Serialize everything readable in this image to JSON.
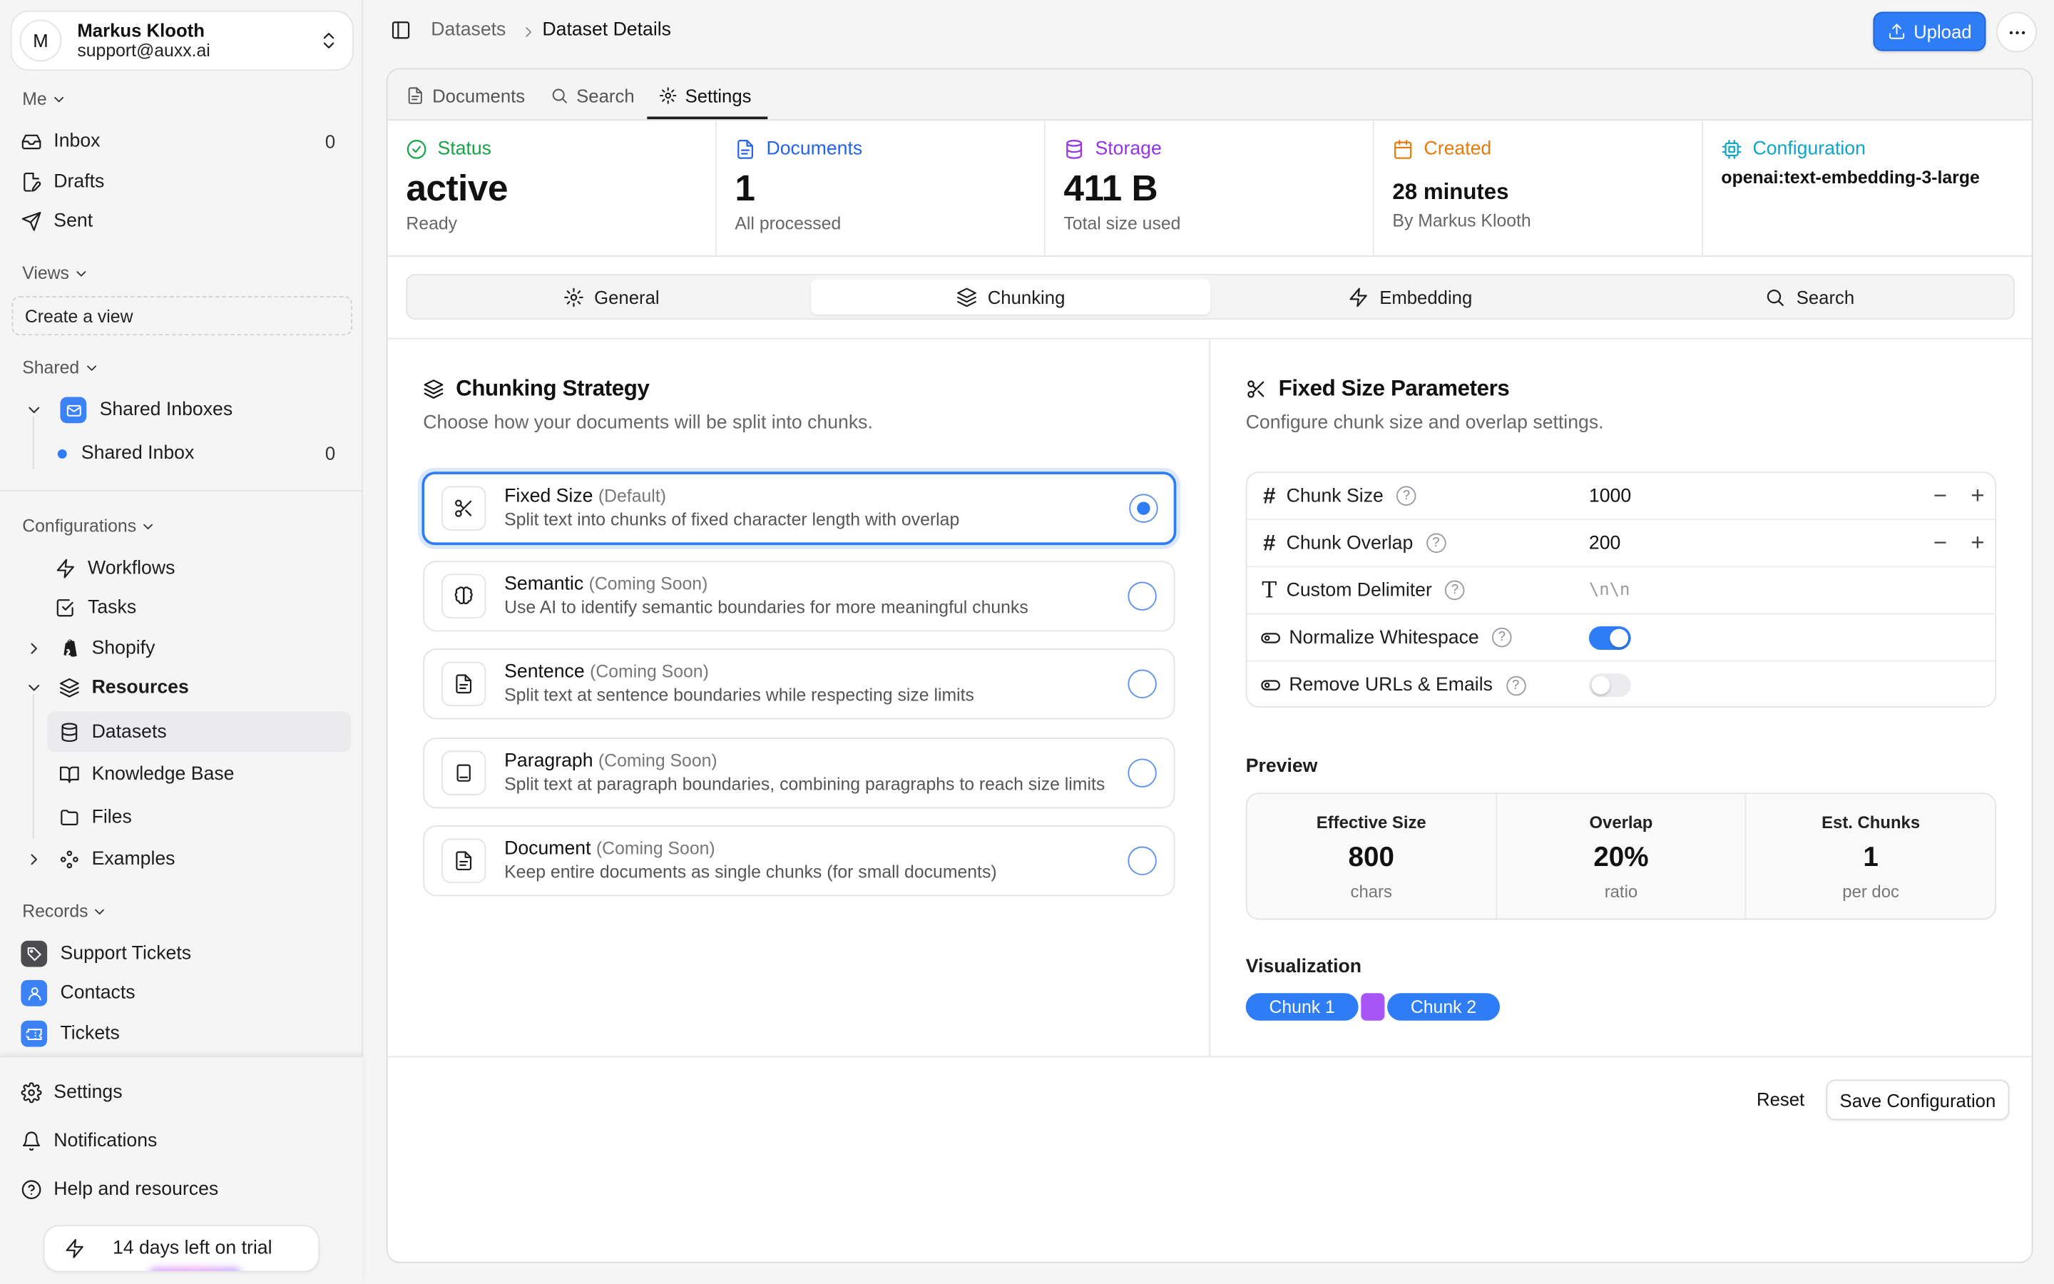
{
  "user": {
    "initial": "M",
    "name": "Markus Klooth",
    "email": "support@auxx.ai"
  },
  "sidebar": {
    "me_label": "Me",
    "inbox": {
      "label": "Inbox",
      "count": "0"
    },
    "drafts": "Drafts",
    "sent": "Sent",
    "views_label": "Views",
    "create_view": "Create a view",
    "shared_label": "Shared",
    "shared_inboxes": "Shared Inboxes",
    "shared_inbox": {
      "label": "Shared Inbox",
      "count": "0"
    },
    "configurations_label": "Configurations",
    "workflows": "Workflows",
    "tasks": "Tasks",
    "shopify": "Shopify",
    "resources": "Resources",
    "datasets": "Datasets",
    "knowledge_base": "Knowledge Base",
    "files": "Files",
    "examples": "Examples",
    "records_label": "Records",
    "support_tickets": "Support Tickets",
    "contacts": "Contacts",
    "tickets": "Tickets",
    "settings": "Settings",
    "notifications": "Notifications",
    "help": "Help and resources",
    "trial": "14 days left on trial"
  },
  "breadcrumb": {
    "parent": "Datasets",
    "current": "Dataset Details"
  },
  "toolbar": {
    "upload": "Upload"
  },
  "tabs": {
    "documents": "Documents",
    "search": "Search",
    "settings": "Settings"
  },
  "stats": {
    "status": {
      "label": "Status",
      "value": "active",
      "sub": "Ready",
      "color": "#16a34a"
    },
    "documents": {
      "label": "Documents",
      "value": "1",
      "sub": "All processed",
      "color": "#2563eb"
    },
    "storage": {
      "label": "Storage",
      "value": "411 B",
      "sub": "Total size used",
      "color": "#9333ea"
    },
    "created": {
      "label": "Created",
      "value": "28 minutes",
      "sub": "By Markus Klooth",
      "color": "#ea7a0c"
    },
    "configuration": {
      "label": "Configuration",
      "value": "openai:text-embedding-3-large",
      "color": "#0ea5c9"
    }
  },
  "subtabs": {
    "general": "General",
    "chunking": "Chunking",
    "embedding": "Embedding",
    "search": "Search"
  },
  "strategy": {
    "title": "Chunking Strategy",
    "desc": "Choose how your documents will be split into chunks.",
    "options": [
      {
        "title": "Fixed Size",
        "tag": "(Default)",
        "desc": "Split text into chunks of fixed character length with overlap"
      },
      {
        "title": "Semantic",
        "tag": "(Coming Soon)",
        "desc": "Use AI to identify semantic boundaries for more meaningful chunks"
      },
      {
        "title": "Sentence",
        "tag": "(Coming Soon)",
        "desc": "Split text at sentence boundaries while respecting size limits"
      },
      {
        "title": "Paragraph",
        "tag": "(Coming Soon)",
        "desc": "Split text at paragraph boundaries, combining paragraphs to reach size limits"
      },
      {
        "title": "Document",
        "tag": "(Coming Soon)",
        "desc": "Keep entire documents as single chunks (for small documents)"
      }
    ]
  },
  "params": {
    "title": "Fixed Size Parameters",
    "desc": "Configure chunk size and overlap settings.",
    "chunk_size": {
      "label": "Chunk Size",
      "value": "1000"
    },
    "chunk_overlap": {
      "label": "Chunk Overlap",
      "value": "200"
    },
    "delimiter": {
      "label": "Custom Delimiter",
      "placeholder": "\\n\\n"
    },
    "normalize": {
      "label": "Normalize Whitespace"
    },
    "remove_urls": {
      "label": "Remove URLs & Emails"
    }
  },
  "preview": {
    "title": "Preview",
    "effective": {
      "label": "Effective Size",
      "value": "800",
      "unit": "chars"
    },
    "overlap": {
      "label": "Overlap",
      "value": "20%",
      "unit": "ratio"
    },
    "chunks": {
      "label": "Est. Chunks",
      "value": "1",
      "unit": "per doc"
    }
  },
  "viz": {
    "title": "Visualization",
    "chunk1": "Chunk 1",
    "chunk2": "Chunk 2"
  },
  "footer": {
    "reset": "Reset",
    "save": "Save Configuration"
  },
  "colors": {
    "accent": "#2f7df6",
    "overlap": "#a855f7"
  }
}
